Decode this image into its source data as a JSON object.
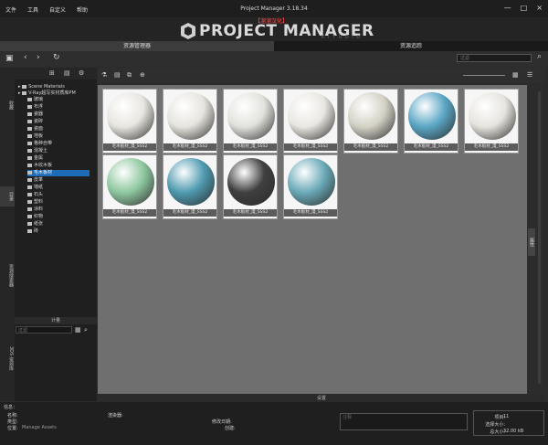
{
  "menu": [
    "文件",
    "工具",
    "自定义",
    "帮助"
  ],
  "window_title": "Project Manager 3.18.34",
  "window_controls": [
    "—",
    "□",
    "×"
  ],
  "brand": {
    "badge": "【溜溜汉化】",
    "name": "PROJECT MANAGER",
    "studio": "K I T U D I O"
  },
  "tabs": [
    "资源管理器",
    "资源追踪"
  ],
  "search_placeholder": "过滤",
  "left_tabs": [
    "收藏",
    "目录",
    "资源搜索器",
    "3DS 资源库"
  ],
  "tree": {
    "root_items": [
      "Scene Materials",
      "V-Ray超写实材质库PM"
    ],
    "children": [
      "玻璃",
      "布浮",
      "瓷器",
      "瓷砖",
      "瓷面",
      "地板",
      "格种自带",
      "混凝土",
      "金属",
      "木纹木板",
      "毛木板材",
      "皮革",
      "墙纸",
      "石头",
      "塑料",
      "涂料",
      "织物",
      "纸张",
      "砖"
    ],
    "selected_index": 10
  },
  "tree_bottom_label": "计量",
  "filter_placeholder": "过滤",
  "gallery": {
    "items": [
      {
        "caption": "毛木板材_漫_SSS2",
        "color": "#e8e6e0"
      },
      {
        "caption": "毛木板材_漫_SSS2",
        "color": "#e6e4de"
      },
      {
        "caption": "毛木板材_漫_SSS2",
        "color": "#e2e2dd"
      },
      {
        "caption": "毛木板材_漫_SSS2",
        "color": "#e9e7e1"
      },
      {
        "caption": "毛木板材_漫_SSS2",
        "color": "#d4d2c6"
      },
      {
        "caption": "毛木板材_漫_SSS2",
        "color": "#5aa6c4"
      },
      {
        "caption": "毛木板材_漫_SSS2",
        "color": "#e6e4de"
      },
      {
        "caption": "毛木板材_漫_SSS2",
        "color": "#8fc8a0"
      },
      {
        "caption": "毛木板材_漫_SSS2",
        "color": "#4f9ab0"
      },
      {
        "caption": "毛木板材_漫_SSS2",
        "color": "#3f3f3f"
      },
      {
        "caption": "毛木板材_漫_SSS2",
        "color": "#6aaab8"
      }
    ]
  },
  "right_panel_label": "属性",
  "gallery_bottom_label": "设置",
  "info": {
    "header": "信息：",
    "labels": [
      "名称:",
      "类型:",
      "位置:"
    ],
    "location_value": "Manage Assets",
    "label_a": "渲染器:",
    "label_b": "修改日期:",
    "label_c": "创建:",
    "comment_placeholder": "注释",
    "stats": [
      {
        "label": "项目:",
        "value": "11"
      },
      {
        "label": "选择大小:",
        "value": ""
      },
      {
        "label": "总大小:",
        "value": "32.00 kB"
      }
    ]
  }
}
